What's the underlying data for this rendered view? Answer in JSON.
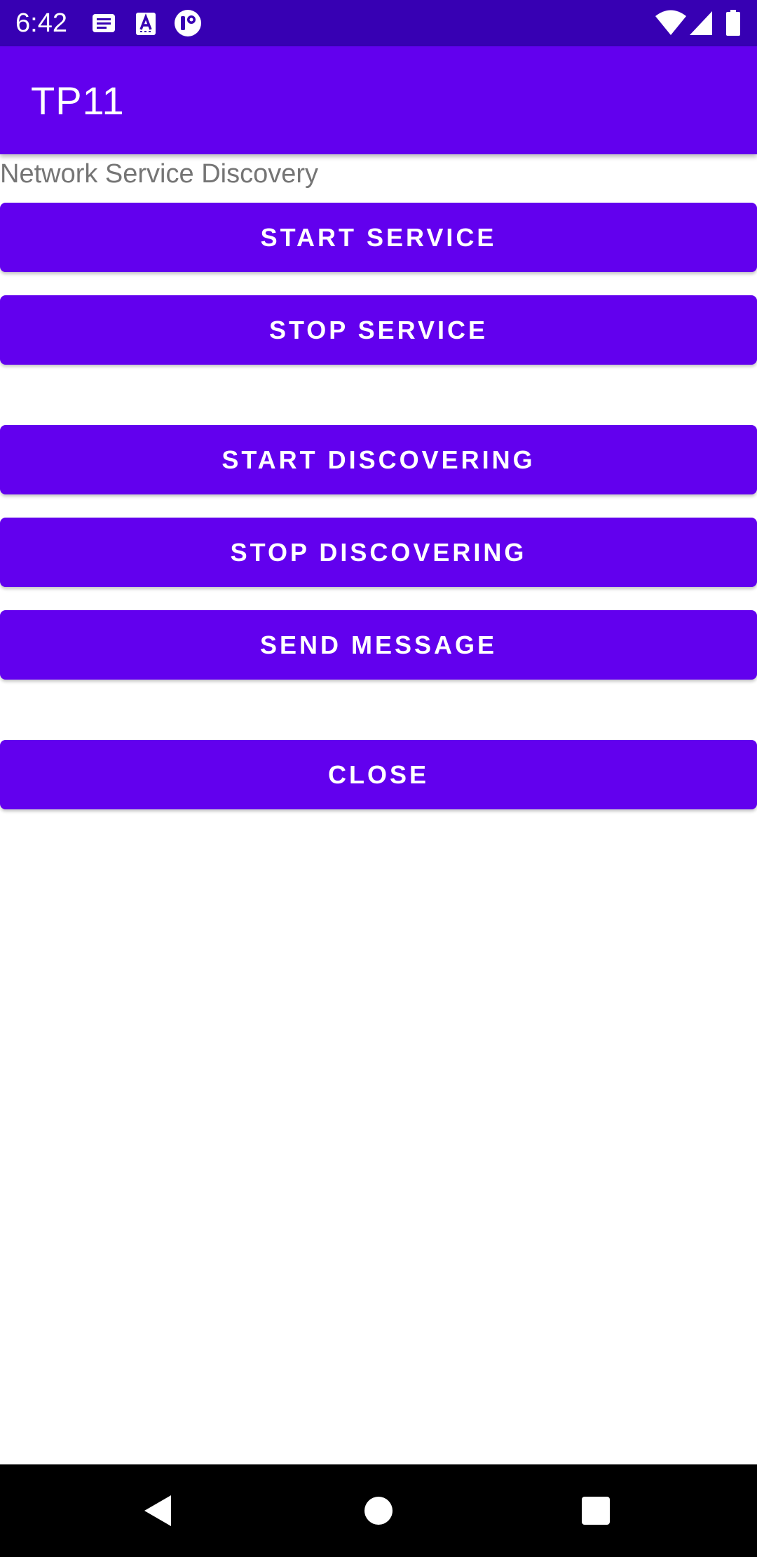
{
  "status_bar": {
    "time": "6:42",
    "left_icons": [
      "message-notification-icon",
      "text-notification-icon",
      "app-notification-icon"
    ],
    "right_icons": [
      "wifi-icon",
      "cell-signal-icon",
      "battery-icon"
    ],
    "background_color": "#3700B3"
  },
  "app_bar": {
    "title": "TP11",
    "background_color": "#6200EE"
  },
  "content": {
    "subtitle": "Network Service Discovery",
    "buttons": {
      "start_service": "START SERVICE",
      "stop_service": "STOP SERVICE",
      "start_discovering": "START DISCOVERING",
      "stop_discovering": "STOP DISCOVERING",
      "send_message": "SEND MESSAGE",
      "close": "CLOSE"
    },
    "button_color": "#6200EE"
  },
  "nav_bar": {
    "buttons": [
      "back-icon",
      "home-icon",
      "recents-icon"
    ]
  }
}
